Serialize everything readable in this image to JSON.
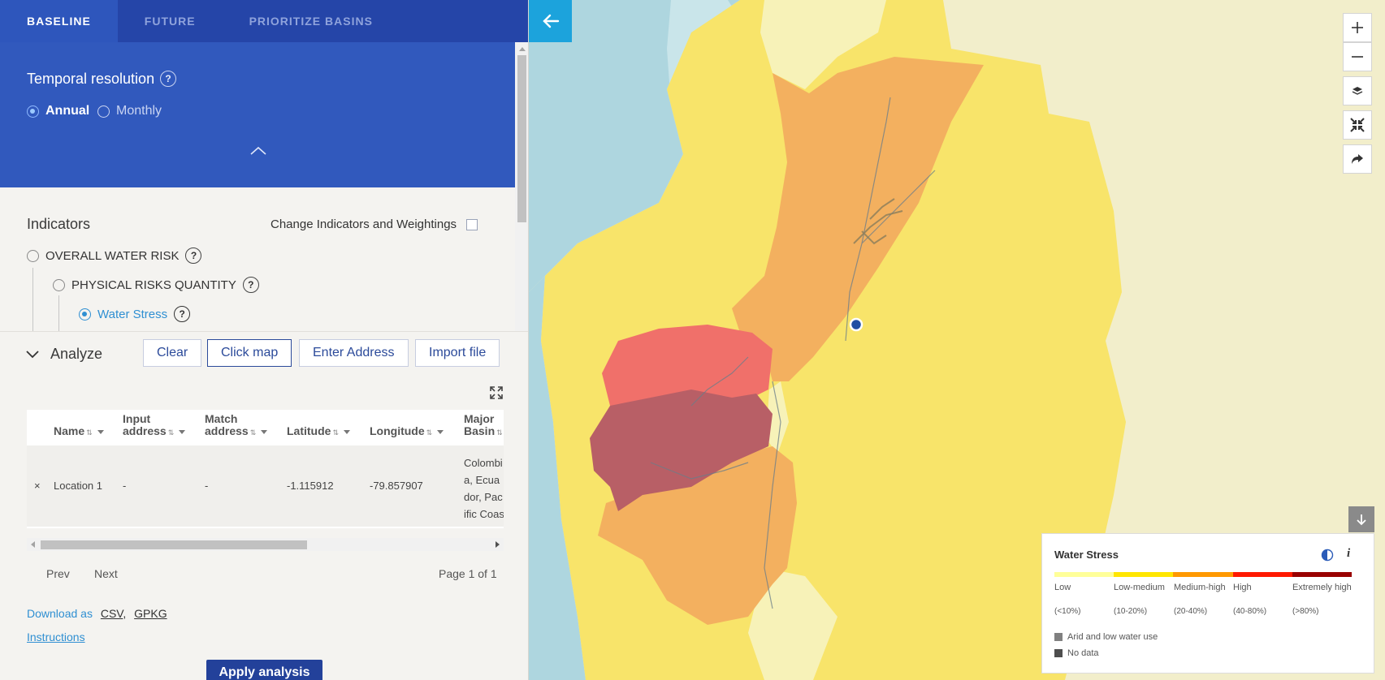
{
  "tabs": [
    {
      "label": "BASELINE",
      "active": true
    },
    {
      "label": "FUTURE",
      "active": false
    },
    {
      "label": "PRIORITIZE BASINS",
      "active": false
    }
  ],
  "temporal": {
    "title": "Temporal resolution",
    "help": "?",
    "options": [
      {
        "label": "Annual",
        "selected": true
      },
      {
        "label": "Monthly",
        "selected": false
      }
    ]
  },
  "indicators": {
    "title": "Indicators",
    "change_label": "Change Indicators and Weightings",
    "change_checked": false,
    "items": [
      {
        "label": "OVERALL WATER RISK",
        "selected": false
      },
      {
        "label": "PHYSICAL RISKS QUANTITY",
        "selected": false
      },
      {
        "label": "Water Stress",
        "selected": true
      }
    ]
  },
  "analyze": {
    "title": "Analyze",
    "buttons": {
      "clear": "Clear",
      "click_map": "Click map",
      "enter_address": "Enter Address",
      "import_file": "Import file"
    },
    "columns": [
      "Name",
      "Input address",
      "Match address",
      "Latitude",
      "Longitude",
      "Major Basin"
    ],
    "rows": [
      {
        "remove": "×",
        "name": "Location 1",
        "input_address": "-",
        "match_address": "-",
        "latitude": "-1.115912",
        "longitude": "-79.857907",
        "major_basin": "Colombia, Ecuador, Pacific Coast"
      }
    ],
    "pager": {
      "prev": "Prev",
      "next": "Next",
      "info": "Page 1 of 1"
    },
    "download_label": "Download as",
    "download_csv": "CSV",
    "download_gpkg": "GPKG",
    "instructions": "Instructions",
    "apply": "Apply analysis"
  },
  "map": {
    "controls": [
      "zoom-in",
      "zoom-out",
      "layers",
      "fullscreen",
      "share"
    ],
    "selected_point": {
      "latitude": -1.115912,
      "longitude": -79.857907
    }
  },
  "legend": {
    "title": "Water Stress",
    "classes": [
      {
        "label": "Low",
        "range": "(<10%)",
        "color": "#ffff99"
      },
      {
        "label": "Low-medium",
        "range": "(10-20%)",
        "color": "#ffe600"
      },
      {
        "label": "Medium-high",
        "range": "(20-40%)",
        "color": "#ff9900"
      },
      {
        "label": "High",
        "range": "(40-80%)",
        "color": "#ff1900"
      },
      {
        "label": "Extremely high",
        "range": "(>80%)",
        "color": "#990000"
      }
    ],
    "arid": {
      "label": "Arid and low water use",
      "color": "#808080"
    },
    "nodata": {
      "label": "No data",
      "color": "#4e4e4e"
    }
  },
  "colors": {
    "tab_bar": "#2545a8",
    "panel_blue": "#3159bd",
    "accent": "#1ca3dc",
    "apply_button": "#23419a"
  }
}
